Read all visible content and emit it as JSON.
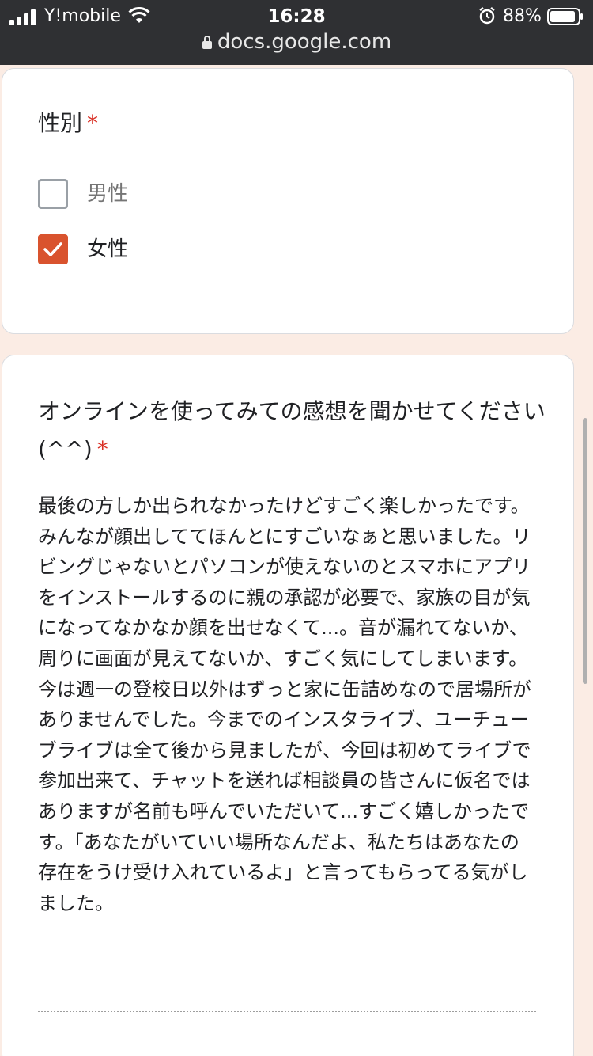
{
  "status": {
    "carrier": "Y!mobile",
    "time": "16:28",
    "battery": "88%",
    "url": "docs.google.com"
  },
  "form": {
    "gender_question": "性別",
    "required_mark": "*",
    "options": [
      {
        "label": "男性",
        "checked": false
      },
      {
        "label": "女性",
        "checked": true
      }
    ],
    "feedback_question": "オンラインを使ってみての感想を聞かせてください(^^)",
    "feedback_answer": "最後の方しか出られなかったけどすごく楽しかったです。みんなが顔出しててほんとにすごいなぁと思いました。リビングじゃないとパソコンが使えないのとスマホにアプリをインストールするのに親の承認が必要で、家族の目が気になってなかなか顔を出せなくて...。音が漏れてないか、周りに画面が見えてないか、すごく気にしてしまいます。\n今は週一の登校日以外はずっと家に缶詰めなので居場所がありませんでした。今までのインスタライブ、ユーチューブライブは全て後から見ましたが、今回は初めてライブで参加出来て、チャットを送れば相談員の皆さんに仮名ではありますが名前も呼んでいただいて...すごく嬉しかったです。「あなたがいていい場所なんだよ、私たちはあなたの存在をうけ受け入れているよ」と言ってもらってる気がしました。"
  },
  "colors": {
    "accent": "#d9532e",
    "required": "#d93025",
    "background": "#fbece4"
  }
}
